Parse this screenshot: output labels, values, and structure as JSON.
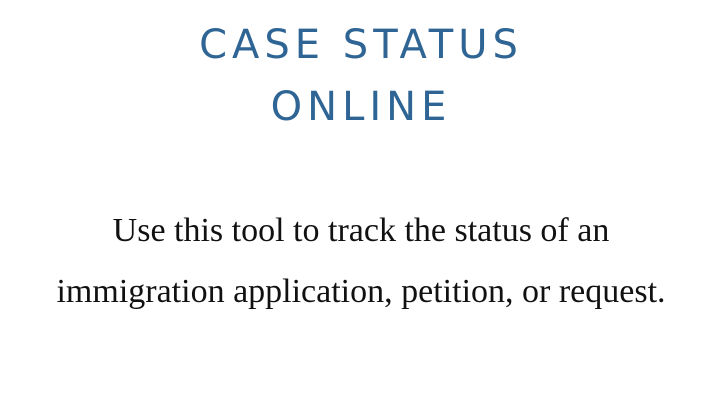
{
  "header": {
    "title_line_1": "CASE STATUS",
    "title_line_2": "ONLINE",
    "title_color": "#2f6594"
  },
  "main": {
    "description": "Use this tool to track the status of an immigration application, petition, or request."
  }
}
